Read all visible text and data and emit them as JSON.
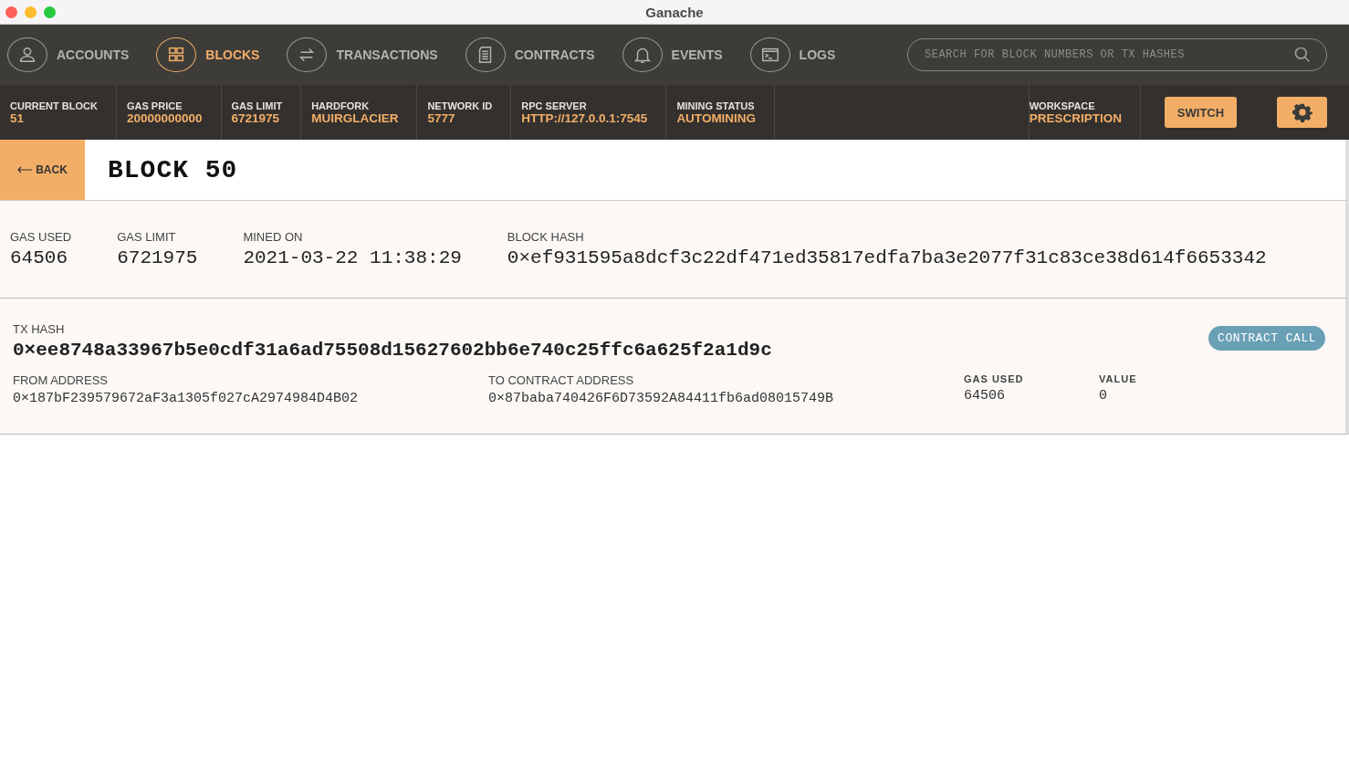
{
  "window": {
    "title": "Ganache"
  },
  "nav": [
    {
      "label": "ACCOUNTS",
      "kind": "accounts",
      "selected": false
    },
    {
      "label": "BLOCKS",
      "kind": "blocks",
      "selected": true
    },
    {
      "label": "TRANSACTIONS",
      "kind": "transactions",
      "selected": false
    },
    {
      "label": "CONTRACTS",
      "kind": "contracts",
      "selected": false
    },
    {
      "label": "EVENTS",
      "kind": "events",
      "selected": false
    },
    {
      "label": "LOGS",
      "kind": "logs",
      "selected": false
    }
  ],
  "search": {
    "placeholder": "SEARCH FOR BLOCK NUMBERS OR TX HASHES"
  },
  "status_bar": [
    {
      "label": "CURRENT BLOCK",
      "value": "51"
    },
    {
      "label": "GAS PRICE",
      "value": "20000000000"
    },
    {
      "label": "GAS LIMIT",
      "value": "6721975"
    },
    {
      "label": "HARDFORK",
      "value": "MUIRGLACIER"
    },
    {
      "label": "NETWORK ID",
      "value": "5777"
    },
    {
      "label": "RPC SERVER",
      "value": "HTTP://127.0.0.1:7545"
    },
    {
      "label": "MINING STATUS",
      "value": "AUTOMINING"
    }
  ],
  "workspace": {
    "label": "WORKSPACE",
    "value": "PRESCRIPTION"
  },
  "switch_button": "SWITCH",
  "back_button": "BACK",
  "block_title": "BLOCK 50",
  "block_details": [
    {
      "label": "GAS USED",
      "value": "64506"
    },
    {
      "label": "GAS LIMIT",
      "value": "6721975"
    },
    {
      "label": "MINED ON",
      "value": "2021-03-22 11:38:29"
    },
    {
      "label": "BLOCK HASH",
      "value": "0×ef931595a8dcf3c22df471ed35817edfa7ba3e2077f31c83ce38d614f6653342"
    }
  ],
  "transactions": [
    {
      "hash_label": "TX HASH",
      "hash": "0×ee8748a33967b5e0cdf31a6ad75508d15627602bb6e740c25ffc6a625f2a1d9c",
      "type_badge": "CONTRACT CALL",
      "fields": [
        {
          "label": "FROM ADDRESS",
          "value": "0×187bF239579672aF3a1305f027cA2974984D4B02",
          "kind": "address"
        },
        {
          "label": "TO CONTRACT ADDRESS",
          "value": "0×87baba740426F6D73592A84411fb6ad08015749B",
          "kind": "address"
        },
        {
          "label": "GAS USED",
          "value": "64506",
          "kind": "number"
        },
        {
          "label": "VALUE",
          "value": "0",
          "kind": "number"
        }
      ]
    }
  ]
}
